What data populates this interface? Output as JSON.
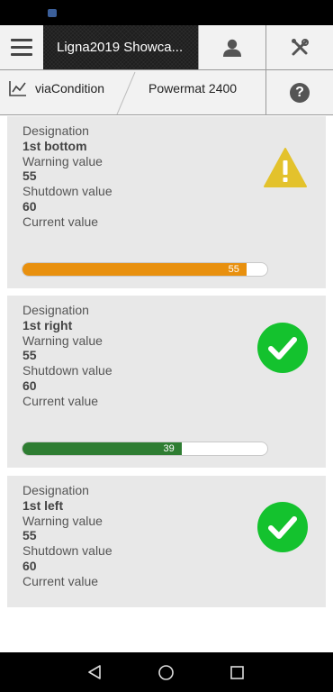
{
  "header": {
    "app_title": "Ligna2019 Showca...",
    "icons": {
      "menu": "menu-icon",
      "user": "user-icon",
      "tools": "tools-icon"
    }
  },
  "breadcrumb": {
    "items": [
      "viaCondition",
      "Powermat 2400"
    ],
    "icons": {
      "chart": "chart-line-icon",
      "help": "help-icon"
    }
  },
  "labels": {
    "designation": "Designation",
    "warning": "Warning value",
    "shutdown": "Shutdown value",
    "current": "Current value"
  },
  "cards": [
    {
      "designation": "1st bottom",
      "warning": "55",
      "shutdown": "60",
      "current": "55",
      "progress_percent": 91.5,
      "status": "warning",
      "bar_color": "#e8900e"
    },
    {
      "designation": "1st right",
      "warning": "55",
      "shutdown": "60",
      "current": "39",
      "progress_percent": 65,
      "status": "ok",
      "bar_color": "#2e7d32"
    },
    {
      "designation": "1st left",
      "warning": "55",
      "shutdown": "60",
      "status": "ok"
    }
  ],
  "colors": {
    "ok_green": "#14c22e",
    "warning_yellow": "#e3c22c",
    "card_bg": "#e8e8e8"
  },
  "navigation": {
    "icons": [
      "back-icon",
      "home-icon",
      "recents-icon"
    ]
  }
}
